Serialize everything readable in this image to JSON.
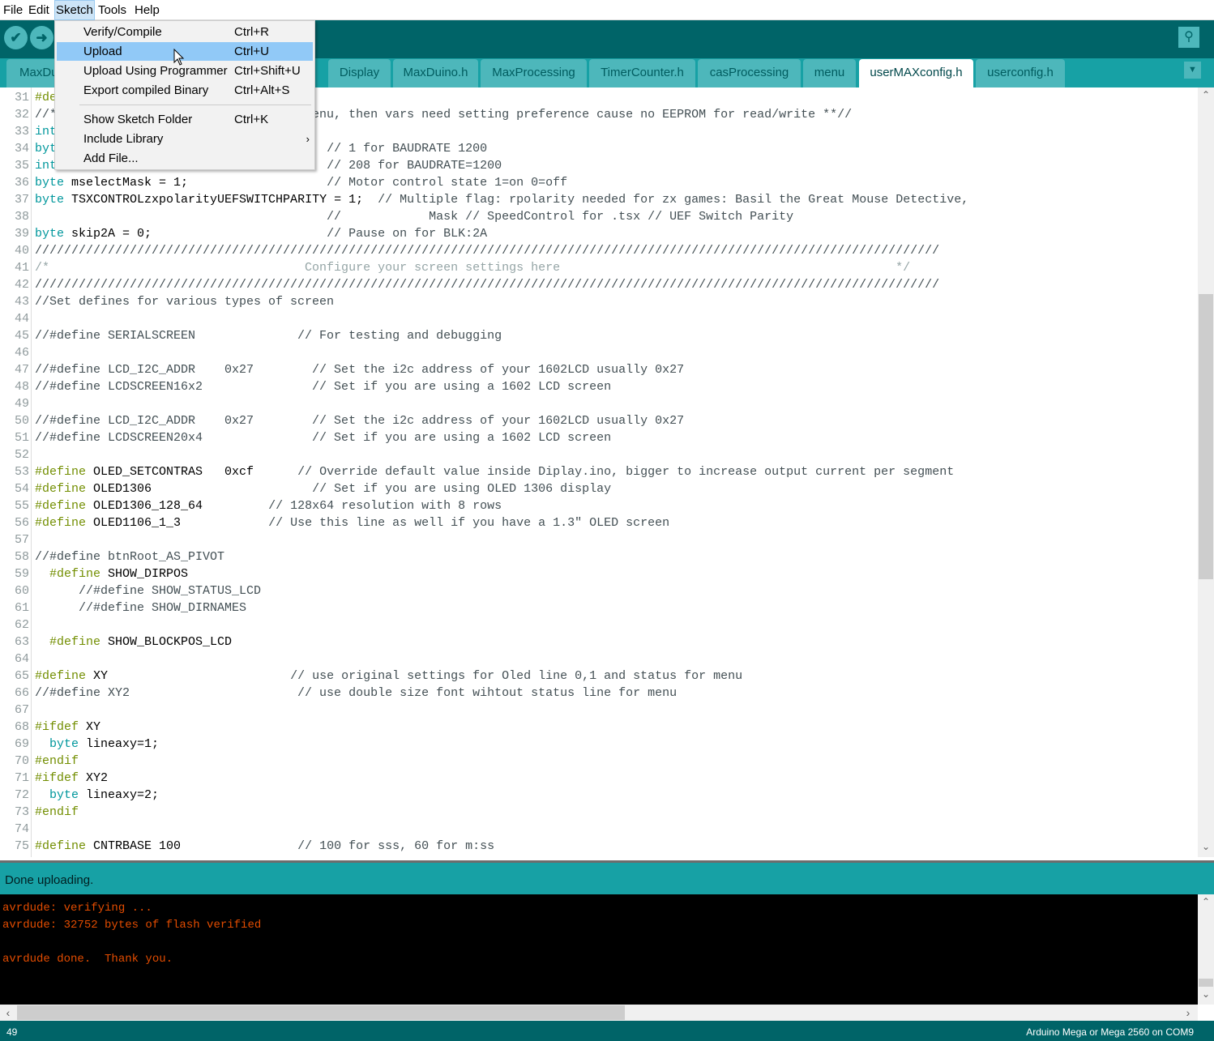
{
  "menubar": [
    "File",
    "Edit",
    "Sketch",
    "Tools",
    "Help"
  ],
  "toolbar": {
    "verify_icon": "checkmark-icon",
    "upload_icon": "arrow-right-icon",
    "serial_icon": "magnifier-icon"
  },
  "tabs": [
    {
      "label": "MaxDu"
    },
    {
      "label": "Display"
    },
    {
      "label": "MaxDuino.h"
    },
    {
      "label": "MaxProcessing"
    },
    {
      "label": "TimerCounter.h"
    },
    {
      "label": "casProcessing"
    },
    {
      "label": "menu"
    },
    {
      "label": "userMAXconfig.h",
      "active": true
    },
    {
      "label": "userconfig.h"
    }
  ],
  "sketch_menu": [
    {
      "label": "Verify/Compile",
      "shortcut": "Ctrl+R"
    },
    {
      "label": "Upload",
      "shortcut": "Ctrl+U",
      "highlighted": true
    },
    {
      "label": "Upload Using Programmer",
      "shortcut": "Ctrl+Shift+U"
    },
    {
      "label": "Export compiled Binary",
      "shortcut": "Ctrl+Alt+S"
    },
    {
      "label": "Show Sketch Folder",
      "shortcut": "Ctrl+K"
    },
    {
      "label": "Include Library",
      "shortcut": "",
      "submenu": "›"
    },
    {
      "label": "Add File...",
      "shortcut": ""
    }
  ],
  "code": [
    {
      "n": "31",
      "s": [
        [
          "d",
          "#de"
        ]
      ]
    },
    {
      "n": "32",
      "s": [
        [
          "c",
          "//*                                   enu, then vars need setting preference cause no EEPROM for read/write **//"
        ]
      ]
    },
    {
      "n": "33",
      "s": [
        [
          "k",
          "int"
        ]
      ]
    },
    {
      "n": "34",
      "s": [
        [
          "k",
          "byt"
        ],
        [
          "c",
          "                                     // 1 for BAUDRATE 1200"
        ]
      ]
    },
    {
      "n": "35",
      "s": [
        [
          "k",
          "int"
        ],
        [
          "c",
          "                                     // 208 for BAUDRATE=1200"
        ]
      ]
    },
    {
      "n": "36",
      "s": [
        [
          "k",
          "byte"
        ],
        [
          "p",
          " mselectMask = 1;                   "
        ],
        [
          "c",
          "// Motor control state 1=on 0=off"
        ]
      ]
    },
    {
      "n": "37",
      "s": [
        [
          "k",
          "byte"
        ],
        [
          "p",
          " TSXCONTROLzxpolarityUEFSWITCHPARITY = 1;  "
        ],
        [
          "c",
          "// Multiple flag: rpolarity needed for zx games: Basil the Great Mouse Detective,"
        ]
      ]
    },
    {
      "n": "38",
      "s": [
        [
          "c",
          "                                        //            Mask // SpeedControl for .tsx // UEF Switch Parity"
        ]
      ]
    },
    {
      "n": "39",
      "s": [
        [
          "k",
          "byte"
        ],
        [
          "p",
          " skip2A = 0;                        "
        ],
        [
          "c",
          "// Pause on for BLK:2A"
        ]
      ]
    },
    {
      "n": "40",
      "s": [
        [
          "c",
          "////////////////////////////////////////////////////////////////////////////////////////////////////////////////////////////"
        ]
      ]
    },
    {
      "n": "41",
      "s": [
        [
          "b",
          "/*                                   Configure your screen settings here                                              */"
        ]
      ]
    },
    {
      "n": "42",
      "s": [
        [
          "c",
          "////////////////////////////////////////////////////////////////////////////////////////////////////////////////////////////"
        ]
      ]
    },
    {
      "n": "43",
      "s": [
        [
          "c",
          "//Set defines for various types of screen"
        ]
      ]
    },
    {
      "n": "44",
      "s": []
    },
    {
      "n": "45",
      "s": [
        [
          "c",
          "//#define SERIALSCREEN              // For testing and debugging"
        ]
      ]
    },
    {
      "n": "46",
      "s": []
    },
    {
      "n": "47",
      "s": [
        [
          "c",
          "//#define LCD_I2C_ADDR    0x27        // Set the i2c address of your 1602LCD usually 0x27"
        ]
      ]
    },
    {
      "n": "48",
      "s": [
        [
          "c",
          "//#define LCDSCREEN16x2               // Set if you are using a 1602 LCD screen"
        ]
      ]
    },
    {
      "n": "49",
      "s": []
    },
    {
      "n": "50",
      "s": [
        [
          "c",
          "//#define LCD_I2C_ADDR    0x27        // Set the i2c address of your 1602LCD usually 0x27"
        ]
      ]
    },
    {
      "n": "51",
      "s": [
        [
          "c",
          "//#define LCDSCREEN20x4               // Set if you are using a 1602 LCD screen"
        ]
      ]
    },
    {
      "n": "52",
      "s": []
    },
    {
      "n": "53",
      "s": [
        [
          "d",
          "#define"
        ],
        [
          "p",
          " OLED_SETCONTRAS   0xcf      "
        ],
        [
          "c",
          "// Override default value inside Diplay.ino, bigger to increase output current per segment"
        ]
      ]
    },
    {
      "n": "54",
      "s": [
        [
          "d",
          "#define"
        ],
        [
          "p",
          " OLED1306                      "
        ],
        [
          "c",
          "// Set if you are using OLED 1306 display"
        ]
      ]
    },
    {
      "n": "55",
      "s": [
        [
          "d",
          "#define"
        ],
        [
          "p",
          " OLED1306_128_64         "
        ],
        [
          "c",
          "// 128x64 resolution with 8 rows"
        ]
      ]
    },
    {
      "n": "56",
      "s": [
        [
          "d",
          "#define"
        ],
        [
          "p",
          " OLED1106_1_3            "
        ],
        [
          "c",
          "// Use this line as well if you have a 1.3\" OLED screen"
        ]
      ]
    },
    {
      "n": "57",
      "s": []
    },
    {
      "n": "58",
      "s": [
        [
          "c",
          "//#define btnRoot_AS_PIVOT"
        ]
      ]
    },
    {
      "n": "59",
      "s": [
        [
          "p",
          "  "
        ],
        [
          "d",
          "#define"
        ],
        [
          "p",
          " SHOW_DIRPOS"
        ]
      ]
    },
    {
      "n": "60",
      "s": [
        [
          "c",
          "      //#define SHOW_STATUS_LCD"
        ]
      ]
    },
    {
      "n": "61",
      "s": [
        [
          "c",
          "      //#define SHOW_DIRNAMES"
        ]
      ]
    },
    {
      "n": "62",
      "s": []
    },
    {
      "n": "63",
      "s": [
        [
          "p",
          "  "
        ],
        [
          "d",
          "#define"
        ],
        [
          "p",
          " SHOW_BLOCKPOS_LCD"
        ]
      ]
    },
    {
      "n": "64",
      "s": []
    },
    {
      "n": "65",
      "s": [
        [
          "d",
          "#define"
        ],
        [
          "p",
          " XY                         "
        ],
        [
          "c",
          "// use original settings for Oled line 0,1 and status for menu"
        ]
      ]
    },
    {
      "n": "66",
      "s": [
        [
          "c",
          "//#define XY2                       // use double size font wihtout status line for menu"
        ]
      ]
    },
    {
      "n": "67",
      "s": []
    },
    {
      "n": "68",
      "s": [
        [
          "d",
          "#ifdef"
        ],
        [
          "p",
          " XY"
        ]
      ]
    },
    {
      "n": "69",
      "s": [
        [
          "p",
          "  "
        ],
        [
          "k",
          "byte"
        ],
        [
          "p",
          " lineaxy=1;"
        ]
      ]
    },
    {
      "n": "70",
      "s": [
        [
          "d",
          "#endif"
        ]
      ]
    },
    {
      "n": "71",
      "s": [
        [
          "d",
          "#ifdef"
        ],
        [
          "p",
          " XY2"
        ]
      ]
    },
    {
      "n": "72",
      "s": [
        [
          "p",
          "  "
        ],
        [
          "k",
          "byte"
        ],
        [
          "p",
          " lineaxy=2;"
        ]
      ]
    },
    {
      "n": "73",
      "s": [
        [
          "d",
          "#endif"
        ]
      ]
    },
    {
      "n": "74",
      "s": []
    },
    {
      "n": "75",
      "s": [
        [
          "d",
          "#define"
        ],
        [
          "p",
          " CNTRBASE 100                "
        ],
        [
          "c",
          "// 100 for sss, 60 for m:ss"
        ]
      ]
    }
  ],
  "status": {
    "message": "Done uploading."
  },
  "console": [
    "avrdude: verifying ...",
    "avrdude: 32752 bytes of flash verified",
    "",
    "avrdude done.  Thank you."
  ],
  "footer": {
    "line": "49",
    "board": "Arduino Mega or Mega 2560 on COM9"
  },
  "colors": {
    "toolbar": "#006468",
    "tabbar": "#17a1a5",
    "keyword": "#00979c",
    "preprocessor": "#728e00",
    "console_text": "#e34c00"
  }
}
